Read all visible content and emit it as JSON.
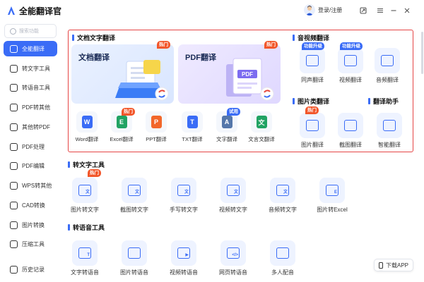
{
  "app": {
    "title": "全能翻译官",
    "login": "登录/注册"
  },
  "sidebar": {
    "search_placeholder": "搜索功能",
    "items": [
      {
        "label": "全能翻译",
        "icon": "home-icon",
        "active": true
      },
      {
        "label": "转文字工具",
        "icon": "text-icon"
      },
      {
        "label": "转语音工具",
        "icon": "voice-icon"
      },
      {
        "label": "PDF转其他",
        "icon": "pdf-icon"
      },
      {
        "label": "其他转PDF",
        "icon": "pdf-convert-icon"
      },
      {
        "label": "PDF处理",
        "icon": "pdf-process-icon"
      },
      {
        "label": "PDF编辑",
        "icon": "pdf-edit-icon"
      },
      {
        "label": "WPS转其他",
        "icon": "wps-icon"
      },
      {
        "label": "CAD转换",
        "icon": "cad-icon"
      },
      {
        "label": "图片转换",
        "icon": "image-icon"
      },
      {
        "label": "压缩工具",
        "icon": "compress-icon"
      },
      {
        "label": "历史记录",
        "icon": "history-icon"
      }
    ]
  },
  "translate": {
    "doc_section": "文档文字翻译",
    "banners": [
      {
        "title": "文档翻译",
        "badge": "热门"
      },
      {
        "title": "PDF翻译",
        "badge": "热门"
      }
    ],
    "doc_tools": [
      {
        "label": "Word翻译",
        "glyph": "W",
        "color": "#3a6cf6"
      },
      {
        "label": "Excel翻译",
        "glyph": "E",
        "color": "#21a363",
        "badge": "热门"
      },
      {
        "label": "PPT翻译",
        "glyph": "P",
        "color": "#f2672a"
      },
      {
        "label": "TXT翻译",
        "glyph": "T",
        "color": "#3a6cf6"
      },
      {
        "label": "文字翻译",
        "glyph": "A",
        "color": "#5577aa",
        "badge": "试用"
      },
      {
        "label": "文言文翻译",
        "glyph": "文",
        "color": "#21a363"
      }
    ],
    "av_section": "音视频翻译",
    "av_tools": [
      {
        "label": "同声翻译",
        "badge": "功能升级"
      },
      {
        "label": "视频翻译",
        "badge": "功能升级"
      },
      {
        "label": "音频翻译"
      }
    ],
    "img_section": "图片类翻译",
    "img_tools": [
      {
        "label": "图片翻译",
        "badge": "热门"
      },
      {
        "label": "截图翻译"
      }
    ],
    "assist_section": "翻译助手",
    "assist_tools": [
      {
        "label": "智能翻译"
      }
    ]
  },
  "to_text": {
    "section": "转文字工具",
    "items": [
      {
        "label": "图片转文字",
        "badge": "热门",
        "glyph": "文"
      },
      {
        "label": "截图转文字",
        "glyph": "文"
      },
      {
        "label": "手写转文字",
        "glyph": "文"
      },
      {
        "label": "视频转文字",
        "glyph": "文"
      },
      {
        "label": "音频转文字",
        "glyph": "文"
      },
      {
        "label": "图片转Excel",
        "glyph": "E"
      }
    ]
  },
  "to_voice": {
    "section": "转语音工具",
    "items": [
      {
        "label": "文字转语音",
        "glyph": "T"
      },
      {
        "label": "图片转语音",
        "glyph": ""
      },
      {
        "label": "视频转语音",
        "glyph": "▶"
      },
      {
        "label": "网页转语音",
        "glyph": "</>"
      },
      {
        "label": "多人配音",
        "glyph": ""
      }
    ]
  },
  "download": {
    "label": "下载APP"
  }
}
